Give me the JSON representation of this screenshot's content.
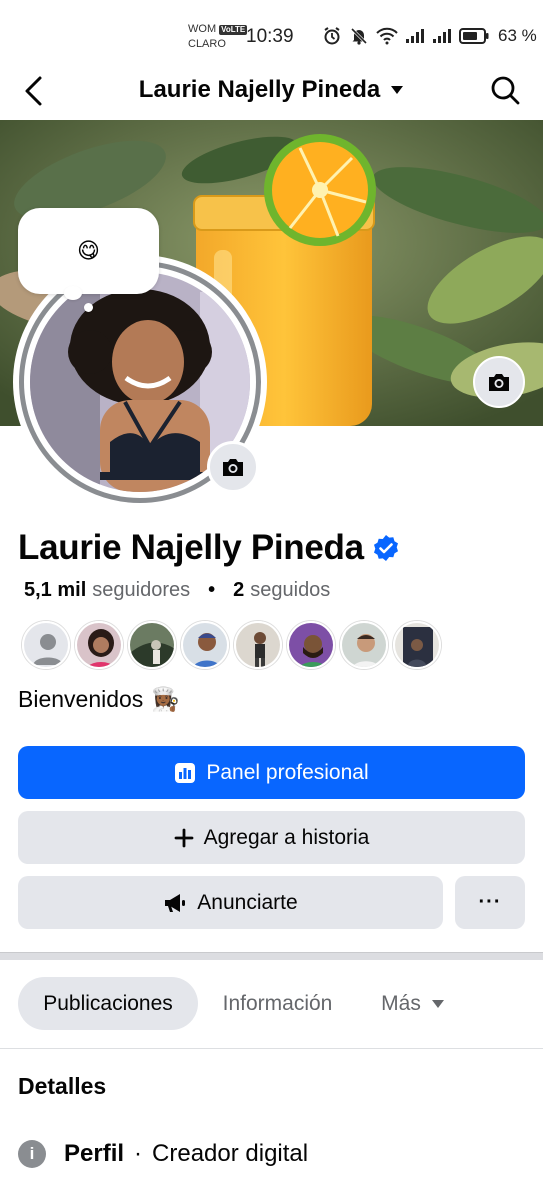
{
  "status_bar": {
    "carrier_line1": "WOM",
    "volte": "VoLTE",
    "carrier_line2": "CLARO",
    "time": "10:39",
    "battery": "63 %",
    "icons": [
      "alarm-icon",
      "mute-icon",
      "wifi-icon",
      "signal-icon",
      "signal-icon",
      "battery-icon"
    ]
  },
  "header": {
    "title": "Laurie Najelly Pineda",
    "back_icon": "back-arrow-icon",
    "dropdown_icon": "caret-down-icon",
    "search_icon": "search-icon"
  },
  "note": {
    "emoji": "😋"
  },
  "profile": {
    "name": "Laurie Najelly Pineda",
    "verified_icon": "verified-badge-icon",
    "followers_count": "5,1 mil",
    "followers_label": "seguidores",
    "separator": "•",
    "following_count": "2",
    "following_label": "seguidos",
    "bio": "Bienvenidos",
    "bio_emoji": "👩🏾‍🍳"
  },
  "buttons": {
    "panel": "Panel profesional",
    "story": "Agregar a historia",
    "ads": "Anunciarte",
    "more": "···"
  },
  "tabs": [
    {
      "label": "Publicaciones",
      "active": true
    },
    {
      "label": "Información",
      "active": false
    },
    {
      "label": "Más",
      "active": false
    }
  ],
  "details": {
    "title": "Detalles",
    "row_label": "Perfil",
    "row_sep": "·",
    "row_value": "Creador digital"
  },
  "colors": {
    "primary": "#0866ff",
    "secondary_bg": "#e4e6eb",
    "verified": "#0866ff",
    "text": "#050505",
    "muted": "#65676b"
  }
}
